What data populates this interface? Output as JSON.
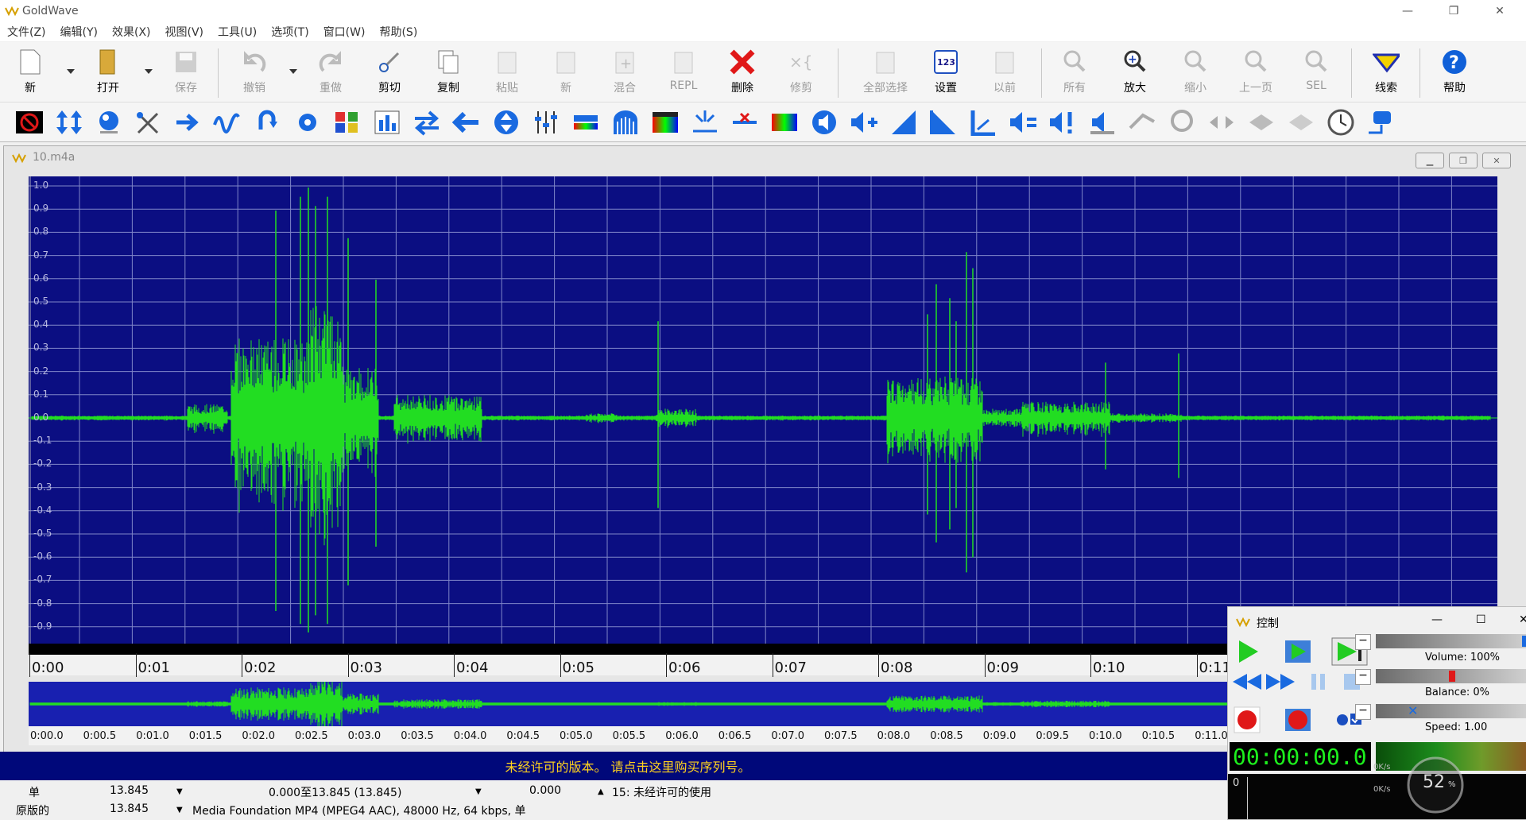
{
  "app": {
    "title": "GoldWave"
  },
  "window_controls": {
    "min": "—",
    "max": "❐",
    "close": "✕"
  },
  "menu": [
    "文件(Z)",
    "编辑(Y)",
    "效果(X)",
    "视图(V)",
    "工具(U)",
    "选项(T)",
    "窗口(W)",
    "帮助(S)"
  ],
  "toolbar": {
    "new": "新",
    "open": "打开",
    "save": "保存",
    "undo": "撤销",
    "redo": "重做",
    "cut": "剪切",
    "copy": "复制",
    "paste": "粘贴",
    "paste_new": "新",
    "mix": "混合",
    "repl": "REPL",
    "delete": "删除",
    "trim": "修剪",
    "select_all": "全部选择",
    "set": "设置",
    "previous": "以前",
    "all": "所有",
    "zoom_in": "放大",
    "zoom_out": "缩小",
    "prev_page": "上一页",
    "sel": "SEL",
    "cue": "线索",
    "help": "帮助"
  },
  "document": {
    "title": "10.m4a",
    "y_labels": [
      "1.0",
      "0.9",
      "0.8",
      "0.7",
      "0.6",
      "0.5",
      "0.4",
      "0.3",
      "0.2",
      "0.1",
      "0.0",
      "-0.1",
      "-0.2",
      "-0.3",
      "-0.4",
      "-0.5",
      "-0.6",
      "-0.7",
      "-0.8",
      "-0.9"
    ],
    "time_labels": [
      "0:00",
      "0:01",
      "0:02",
      "0:03",
      "0:04",
      "0:05",
      "0:06",
      "0:07",
      "0:08",
      "0:09",
      "0:10",
      "0:11"
    ],
    "overview_labels": [
      "0:00.0",
      "0:00.5",
      "0:01.0",
      "0:01.5",
      "0:02.0",
      "0:02.5",
      "0:03.0",
      "0:03.5",
      "0:04.0",
      "0:04.5",
      "0:05.0",
      "0:05.5",
      "0:06.0",
      "0:06.5",
      "0:07.0",
      "0:07.5",
      "0:08.0",
      "0:08.5",
      "0:09.0",
      "0:09.5",
      "0:10.0",
      "0:10.5",
      "0:11.0"
    ]
  },
  "banner": "未经许可的版本。 请点击这里购买序列号。",
  "status": {
    "row1": {
      "label": "单",
      "length": "13.845",
      "range": "0.000至13.845 (13.845)",
      "position": "0.000",
      "message": "15: 未经许可的使用"
    },
    "row2": {
      "label": "原版的",
      "length": "13.845",
      "format": "Media Foundation MP4 (MPEG4 AAC), 48000 Hz, 64 kbps, 单"
    }
  },
  "control": {
    "title": "控制",
    "volume": "Volume: 100%",
    "balance": "Balance: 0%",
    "speed": "Speed: 1.00",
    "time": "00:00:00.0",
    "scope_zero": "0"
  },
  "gauge": {
    "percent": "52",
    "unit": "%",
    "rate1": "0K/s",
    "rate2": "0K/s"
  },
  "colors": {
    "wave_bg": "#0b0e82",
    "wave": "#22dd22",
    "banner_text": "#ffd21e"
  }
}
